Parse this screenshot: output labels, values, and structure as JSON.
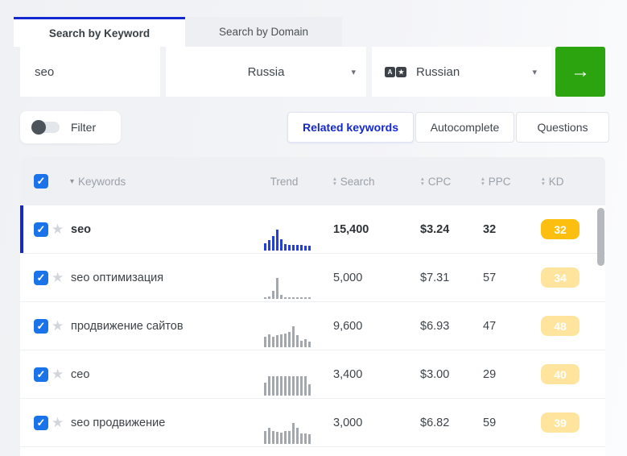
{
  "colors": {
    "accent_blue": "#1428d1",
    "checkbox_blue": "#1a73e8",
    "button_green": "#2ca410",
    "kd_solid": "#fdbf0f",
    "kd_light": "#ffe49e",
    "trend_blue": "#2440d8",
    "trend_gray": "#a3a8af"
  },
  "top_tabs": {
    "keyword_label": "Search by Keyword",
    "domain_label": "Search by Domain",
    "active": "Search by Keyword"
  },
  "search_bar": {
    "query": "seo",
    "region": "Russia",
    "language": "Russian",
    "submit_icon": "arrow-right"
  },
  "filter": {
    "label": "Filter",
    "enabled": false
  },
  "result_tabs": {
    "related_label": "Related keywords",
    "autocomplete_label": "Autocomplete",
    "questions_label": "Questions",
    "active": "Related keywords"
  },
  "table": {
    "header": {
      "keywords": "Keywords",
      "trend": "Trend",
      "search": "Search",
      "cpc": "CPC",
      "ppc": "PPC",
      "kd": "KD"
    },
    "rows": [
      {
        "keyword": "seo",
        "search": "15,400",
        "cpc": "$3.24",
        "ppc": "32",
        "kd": "32",
        "kd_style": "solid",
        "trend_color": "blue",
        "highlighted": true,
        "checked": true,
        "trend": [
          0.35,
          0.5,
          0.68,
          1,
          0.55,
          0.3,
          0.26,
          0.26,
          0.26,
          0.26,
          0.24,
          0.22
        ]
      },
      {
        "keyword": "seo оптимизация",
        "search": "5,000",
        "cpc": "$7.31",
        "ppc": "57",
        "kd": "34",
        "kd_style": "light",
        "trend_color": "gray",
        "highlighted": false,
        "checked": true,
        "trend": [
          0.08,
          0.12,
          0.38,
          1,
          0.2,
          0.08,
          0.06,
          0.06,
          0.06,
          0.06,
          0.06,
          0.06
        ]
      },
      {
        "keyword": "продвижение сайтов",
        "search": "9,600",
        "cpc": "$6.93",
        "ppc": "47",
        "kd": "48",
        "kd_style": "light",
        "trend_color": "gray",
        "highlighted": false,
        "checked": true,
        "trend": [
          0.5,
          0.62,
          0.5,
          0.56,
          0.6,
          0.64,
          0.72,
          1,
          0.56,
          0.3,
          0.38,
          0.26
        ]
      },
      {
        "keyword": "сео",
        "search": "3,400",
        "cpc": "$3.00",
        "ppc": "29",
        "kd": "40",
        "kd_style": "light",
        "trend_color": "gray",
        "highlighted": false,
        "checked": true,
        "trend": [
          0.62,
          0.92,
          0.92,
          0.92,
          0.92,
          0.92,
          0.92,
          0.92,
          0.92,
          0.92,
          0.92,
          0.55
        ]
      },
      {
        "keyword": "seo продвижение",
        "search": "3,000",
        "cpc": "$6.82",
        "ppc": "59",
        "kd": "39",
        "kd_style": "light",
        "trend_color": "gray",
        "highlighted": false,
        "checked": true,
        "trend": [
          0.6,
          0.78,
          0.6,
          0.58,
          0.55,
          0.6,
          0.62,
          1,
          0.78,
          0.5,
          0.5,
          0.45
        ]
      }
    ]
  }
}
